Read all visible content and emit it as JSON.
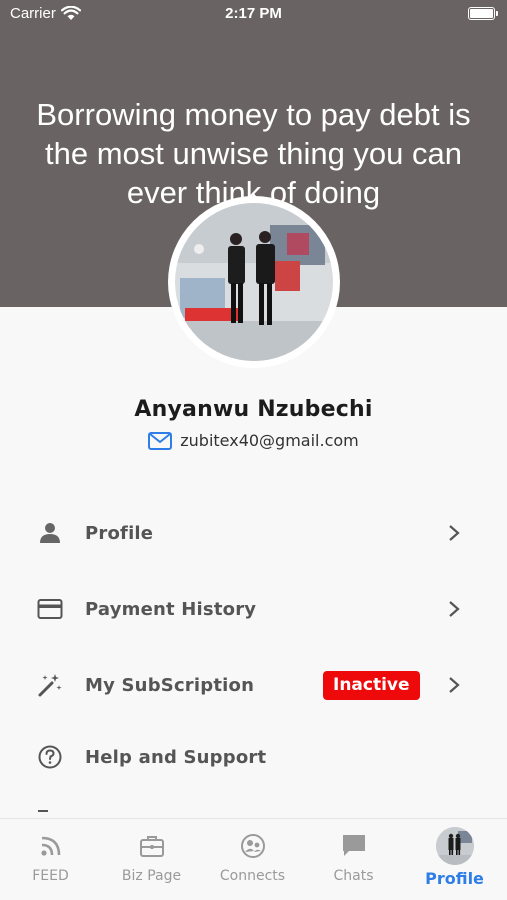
{
  "status_bar": {
    "carrier": "Carrier",
    "time": "2:17 PM"
  },
  "header": {
    "quote": "Borrowing money to pay debt is the most unwise thing you can ever think of doing"
  },
  "user": {
    "name": "Anyanwu Nzubechi",
    "email": "zubitex40@gmail.com"
  },
  "menu": {
    "items": [
      {
        "label": "Profile",
        "icon": "person-icon"
      },
      {
        "label": "Payment History",
        "icon": "credit-card-icon"
      },
      {
        "label": "My SubScription",
        "icon": "magic-wand-icon",
        "badge": "Inactive"
      },
      {
        "label": "Help and Support",
        "icon": "help-circle-icon"
      }
    ]
  },
  "tabs": [
    {
      "label": "FEED",
      "icon": "rss-icon"
    },
    {
      "label": "Biz Page",
      "icon": "briefcase-icon"
    },
    {
      "label": "Connects",
      "icon": "connects-icon"
    },
    {
      "label": "Chats",
      "icon": "chat-bubble-icon"
    },
    {
      "label": "Profile",
      "icon": "profile-avatar",
      "active": true
    }
  ],
  "colors": {
    "header_bg": "#6a6363",
    "badge_red": "#ee0a0a",
    "active_tab": "#2f7de6",
    "email_icon": "#2f7de6"
  }
}
